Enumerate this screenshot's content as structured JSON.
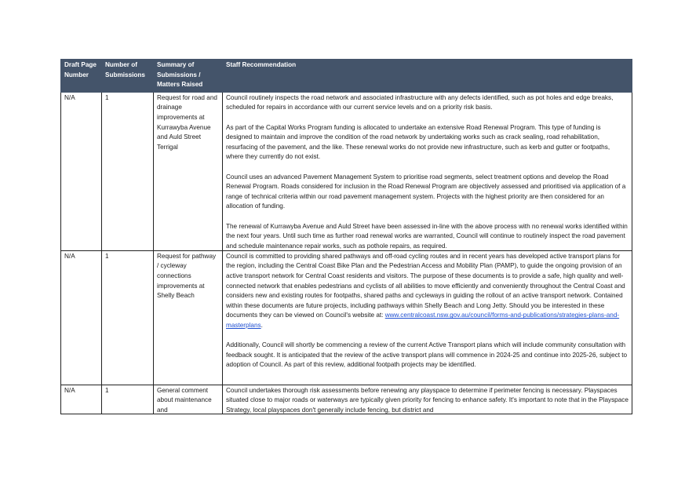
{
  "table": {
    "headers": {
      "page": "Draft Page Number",
      "count": "Number of Submissions",
      "summary": "Summary of Submissions / Matters Raised",
      "recommendation": "Staff Recommendation"
    },
    "rows": [
      {
        "page": "N/A",
        "count": "1",
        "summary": "Request for road and drainage improvements at Kurrawyba Avenue and Auld Street Terrigal",
        "paragraphs": [
          "Council routinely inspects the road network and associated infrastructure with any defects identified, such as pot holes and edge breaks, scheduled for repairs in accordance with our current service levels and on a priority risk basis.",
          "As part of the Capital Works Program funding is allocated to undertake an extensive Road Renewal Program. This type of funding is designed to maintain and improve the condition of the road network by undertaking works such as crack sealing, road rehabilitation, resurfacing of the pavement, and the like. These renewal works do not provide new infrastructure, such as kerb and gutter or footpaths, where they currently do not exist.",
          "Council uses an advanced Pavement Management System to prioritise road segments, select treatment options and develop the Road Renewal Program. Roads considered for inclusion in the Road Renewal Program are objectively assessed and prioritised via application of a range of technical criteria within our road pavement management system. Projects with the highest priority are then considered for an allocation of funding.",
          "The renewal of Kurrawyba Avenue and Auld Street have been assessed in-line with the above process with no renewal works identified within the next four years. Until such time as further road renewal works are warranted, Council will continue to routinely inspect the road pavement and schedule maintenance repair works, such as pothole repairs, as required."
        ]
      },
      {
        "page": "N/A",
        "count": "1",
        "summary": "Request for pathway / cycleway connections improvements at Shelly Beach",
        "para1": "Council is committed to providing shared pathways and off-road cycling routes and in recent years has developed active transport plans for the region, including the Central Coast Bike Plan and the Pedestrian Access and Mobility Plan (PAMP), to guide the ongoing provision of an active transport network for Central Coast residents and visitors. The purpose of these documents is to provide a safe, high quality and well-connected network that enables pedestrians and cyclists of all abilities to move efficiently and conveniently throughout the Central Coast and considers new and existing routes for footpaths, shared paths and cycleways in guiding the rollout of an active transport network.  Contained within these documents are future projects, including pathways within Shelly Beach and Long Jetty. Should you be interested in these documents they can be viewed on Council's website at:",
        "link": "www.centralcoast.nsw.gov.au/council/forms-and-publications/strategies-plans-and-masterplans",
        "link_end": ".",
        "para2": "Additionally, Council will shortly be commencing a review of the current Active Transport plans which will include community consultation with feedback sought. It is anticipated that the review of the active transport plans will commence in 2024-25 and continue into 2025-26, subject to adoption of Council. As part of this review, additional footpath projects may be identified."
      },
      {
        "page": "N/A",
        "count": "1",
        "summary": "General comment about maintenance and",
        "paragraphs": [
          "Council undertakes thorough risk assessments before renewing any playspace to determine if perimeter fencing is necessary. Playspaces situated close to major roads or waterways are typically given priority for fencing to enhance safety. It's important to note that in the Playspace Strategy, local playspaces don't generally include fencing, but district and"
        ]
      }
    ]
  }
}
